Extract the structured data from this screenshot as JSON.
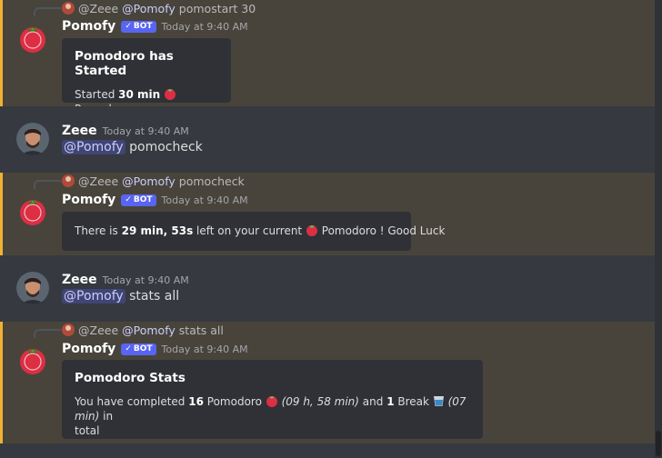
{
  "messages": [
    {
      "reply": {
        "user": "@Zeee",
        "mention": "@Pomofy",
        "text": "pomostart 30"
      },
      "author": "Pomofy",
      "bot_badge": "BOT",
      "timestamp": "Today at 9:40 AM",
      "embed": {
        "title": "Pomodoro has Started",
        "desc_pre": "Started ",
        "desc_bold": "30 min",
        "desc_post": " Pomodoro"
      }
    },
    {
      "author": "Zeee",
      "timestamp": "Today at 9:40 AM",
      "mention": "@Pomofy",
      "text": "pomocheck"
    },
    {
      "reply": {
        "user": "@Zeee",
        "mention": "@Pomofy",
        "text": "pomocheck"
      },
      "author": "Pomofy",
      "bot_badge": "BOT",
      "timestamp": "Today at 9:40 AM",
      "embed": {
        "desc_pre": "There is ",
        "desc_bold": "29 min, 53s",
        "desc_mid": " left on your current ",
        "desc_post": " Pomodoro ! Good Luck"
      }
    },
    {
      "author": "Zeee",
      "timestamp": "Today at 9:40 AM",
      "mention": "@Pomofy",
      "text": "stats all"
    },
    {
      "reply": {
        "user": "@Zeee",
        "mention": "@Pomofy",
        "text": "stats all"
      },
      "author": "Pomofy",
      "bot_badge": "BOT",
      "timestamp": "Today at 9:40 AM",
      "embed": {
        "title": "Pomodoro Stats",
        "p1": "You have completed ",
        "b1": "16",
        "p2": " Pomodoro ",
        "i1": "(09 h, 58 min)",
        "p3": " and ",
        "b2": "1",
        "p4": " Break ",
        "i2": "(07 min)",
        "p5": " in",
        "p6": "total"
      }
    }
  ],
  "icons": {
    "tomato": "tomato-icon",
    "cup": "water-cup-icon",
    "check": "check-icon"
  },
  "colors": {
    "highlight_bg": "#48443b",
    "highlight_bar": "#f0b232",
    "bot_badge": "#5865f2",
    "mention": "#c9cdfb"
  }
}
